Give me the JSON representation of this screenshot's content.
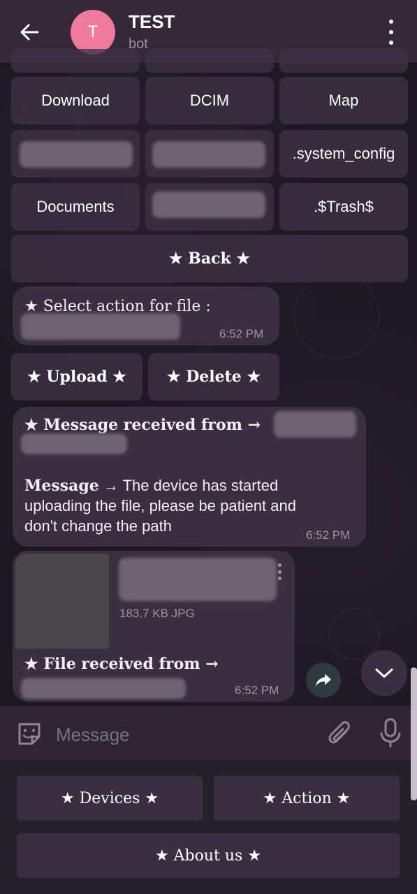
{
  "header": {
    "title": "TEST",
    "subtitle": "bot",
    "avatar_letter": "T"
  },
  "keyboard_top": {
    "row1": [
      "Download",
      "DCIM",
      "Map"
    ],
    "row2_right": ".system_config",
    "row3_left": "Documents",
    "row3_right": ".$Trash$",
    "back": "★ Back ★"
  },
  "msg1": {
    "text": "★ Select action for file :",
    "time": "6:52 PM"
  },
  "actions": {
    "upload": "★ Upload ★",
    "delete": "★ Delete ★"
  },
  "msg2": {
    "header": "★ Message received from →",
    "message_label": "Message",
    "arrow": "→",
    "body_line1": "The device has started",
    "body_line2": "uploading the file, please be patient and",
    "body_line3": "don't change the path",
    "time": "6:52 PM"
  },
  "msg3": {
    "file_meta": "183.7 KB JPG",
    "header": "★ File received from →",
    "time": "6:52 PM"
  },
  "input": {
    "placeholder": "Message"
  },
  "bottom_keyboard": {
    "devices": "★ Devices ★",
    "action": "★ Action ★",
    "about": "★ About us ★"
  }
}
